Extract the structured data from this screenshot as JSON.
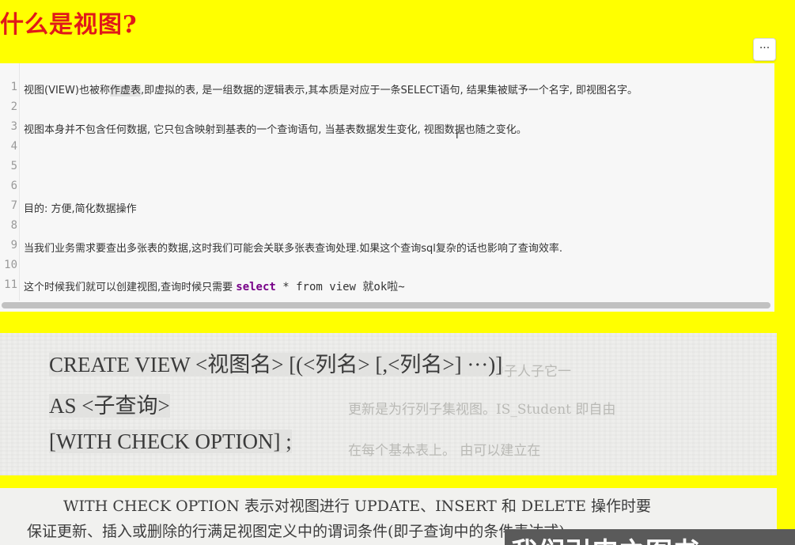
{
  "page_title": "什么是视图?",
  "more_button_label": "···",
  "editor": {
    "lines": [
      {
        "no": "1",
        "text_pre": "视图(VIEW)也被称",
        "text_hl": "作虚表",
        "text_post": ",即虚拟的表, 是一组数据的逻辑表示,其本质是对应于一条SELECT语句, 结果集被赋予一个名字, 即视图名字。"
      },
      {
        "no": "2",
        "text": ""
      },
      {
        "no": "3",
        "text": "视图本身并不包含任何数据, 它只包含映射到基表的一个查询语句, 当基表数据发生变化, 视图数据也随之变化。"
      },
      {
        "no": "4",
        "text": ""
      },
      {
        "no": "5",
        "text": ""
      },
      {
        "no": "6",
        "text": ""
      },
      {
        "no": "7",
        "text": "目的: 方便,简化数据操作"
      },
      {
        "no": "8",
        "text": ""
      },
      {
        "no": "9",
        "text": "当我们业务需求要查出多张表的数据,这时我们可能会关联多张表查询处理.如果这个查询sql复杂的话也影响了查询效率."
      },
      {
        "no": "10",
        "text": ""
      },
      {
        "no": "11",
        "text_pre": "这个时候我们就可以创建视图,查询时候只需要 ",
        "keyword": "select",
        "text_post": " * from view 就ok啦~"
      }
    ]
  },
  "scan_syntax": {
    "line1": "CREATE VIEW <视图名> [(<列名> [,<列名>] ···)]",
    "line2": "AS <子查询>",
    "line3": "[WITH CHECK OPTION] ;",
    "ghost1": "中子人子它一",
    "ghost2": "更新是为行列子集视图。IS_Student 即自由",
    "ghost3": "在每个基本表上。 由可以建立在"
  },
  "scan_desc": {
    "line1": "WITH CHECK OPTION 表示对视图进行 UPDATE、INSERT 和 DELETE 操作时要",
    "line2": "保证更新、插入或删除的行满足视图定义中的谓词条件(即子查询中的条件表达式)。"
  },
  "subtitle": "我们引申之图书",
  "colors": {
    "background": "#ffff00",
    "title": "#e01919",
    "keyword": "#770088",
    "editor_bg": "#f7f7f7"
  }
}
